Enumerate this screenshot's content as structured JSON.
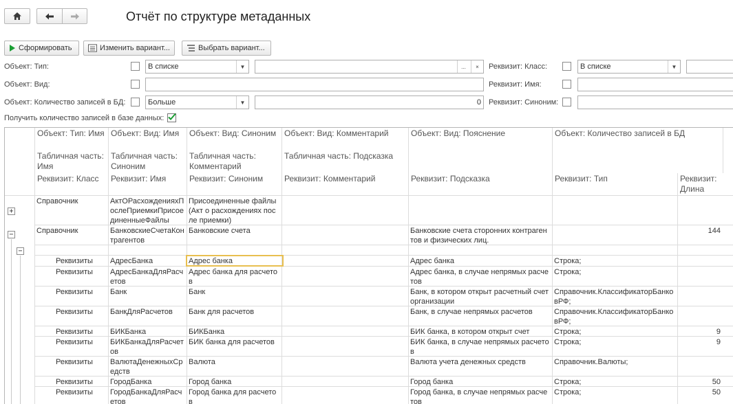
{
  "title": "Отчёт по структуре метаданных",
  "nav": {
    "home_icon": "home-icon",
    "back_icon": "arrow-left-icon",
    "forward_icon": "arrow-right-icon"
  },
  "toolbar": {
    "generate_label": "Сформировать",
    "change_variant_label": "Изменить вариант...",
    "choose_variant_label": "Выбрать вариант..."
  },
  "filters": {
    "obj_type_label": "Объект: Тип:",
    "obj_type_mode": "В списке",
    "obj_type_more": "...",
    "obj_type_clear": "×",
    "obj_view_label": "Объект: Вид:",
    "obj_count_label": "Объект: Количество записей в БД:",
    "obj_count_mode": "Больше",
    "obj_count_value": "0",
    "req_class_label": "Реквизит: Класс:",
    "req_class_mode": "В списке",
    "req_name_label": "Реквизит: Имя:",
    "req_syn_label": "Реквизит: Синоним:",
    "get_count_label": "Получить количество записей в базе данных:",
    "get_count_checked": true
  },
  "table": {
    "header": {
      "r1": [
        "Объект: Тип: Имя",
        "Объект: Вид: Имя",
        "Объект: Вид: Синоним",
        "Объект: Вид: Комментарий",
        "Объект: Вид: Пояснение",
        "Объект: Количество записей в БД"
      ],
      "r2": [
        "Табличная часть: Имя",
        "Табличная часть: Синоним",
        "Табличная часть: Комментарий",
        "Табличная часть: Подсказка"
      ],
      "r3": [
        "Реквизит: Класс",
        "Реквизит: Имя",
        "Реквизит: Синоним",
        "Реквизит: Комментарий",
        "Реквизит: Подсказка",
        "Реквизит: Тип",
        "Реквизит: Длина"
      ]
    },
    "rows": [
      {
        "c0": "Справочник",
        "c1": "АктОРасхожденияхПослеПриемкиПрисоединенныеФайлы",
        "c2": "Присоединенные файлы (Акт о расхождениях после приемки)",
        "c4": "",
        "c5": "",
        "c6": ""
      },
      {
        "c0": "Справочник",
        "c1": "БанковскиеСчетаКонтрагентов",
        "c2": "Банковские счета",
        "c4": "Банковские счета сторонних контрагентов и физических лиц.",
        "c5": "",
        "c6": "144"
      },
      {
        "c0": "",
        "c1": "",
        "c2": "",
        "c4": "",
        "c5": "",
        "c6": ""
      },
      {
        "c0": "Реквизиты",
        "c1": "АдресБанка",
        "c2": "Адрес банка",
        "c4": "Адрес банка",
        "c5": "Строка;",
        "c6": ""
      },
      {
        "c0": "Реквизиты",
        "c1": "АдресБанкаДляРасчетов",
        "c2": "Адрес банка для расчетов",
        "c4": "Адрес банка, в случае непрямых расчетов",
        "c5": "Строка;",
        "c6": ""
      },
      {
        "c0": "Реквизиты",
        "c1": "Банк",
        "c2": "Банк",
        "c4": "Банк, в котором открыт расчетный счет организации",
        "c5": "Справочник.КлассификаторБанковРФ;",
        "c6": ""
      },
      {
        "c0": "Реквизиты",
        "c1": "БанкДляРасчетов",
        "c2": "Банк для расчетов",
        "c4": "Банк, в случае непрямых расчетов",
        "c5": "Справочник.КлассификаторБанковРФ;",
        "c6": ""
      },
      {
        "c0": "Реквизиты",
        "c1": "БИКБанка",
        "c2": "БИКБанка",
        "c4": "БИК банка, в котором открыт счет",
        "c5": "Строка;",
        "c6": "9"
      },
      {
        "c0": "Реквизиты",
        "c1": "БИКБанкаДляРасчетов",
        "c2": "БИК банка для расчетов",
        "c4": "БИК банка, в случае непрямых расчетов",
        "c5": "Строка;",
        "c6": "9"
      },
      {
        "c0": "Реквизиты",
        "c1": "ВалютаДенежныхСредств",
        "c2": "Валюта",
        "c4": "Валюта учета денежных средств",
        "c5": "Справочник.Валюты;",
        "c6": ""
      },
      {
        "c0": "Реквизиты",
        "c1": "ГородБанка",
        "c2": "Город банка",
        "c4": "Город банка",
        "c5": "Строка;",
        "c6": "50"
      },
      {
        "c0": "Реквизиты",
        "c1": "ГородБанкаДляРасчетов",
        "c2": "Город банка для расчетов",
        "c4": "Город банка, в случае непрямых расчетов",
        "c5": "Строка;",
        "c6": "50"
      }
    ]
  },
  "colors": {
    "accent_green": "#1a9e33",
    "selection": "#e8bf4f"
  }
}
